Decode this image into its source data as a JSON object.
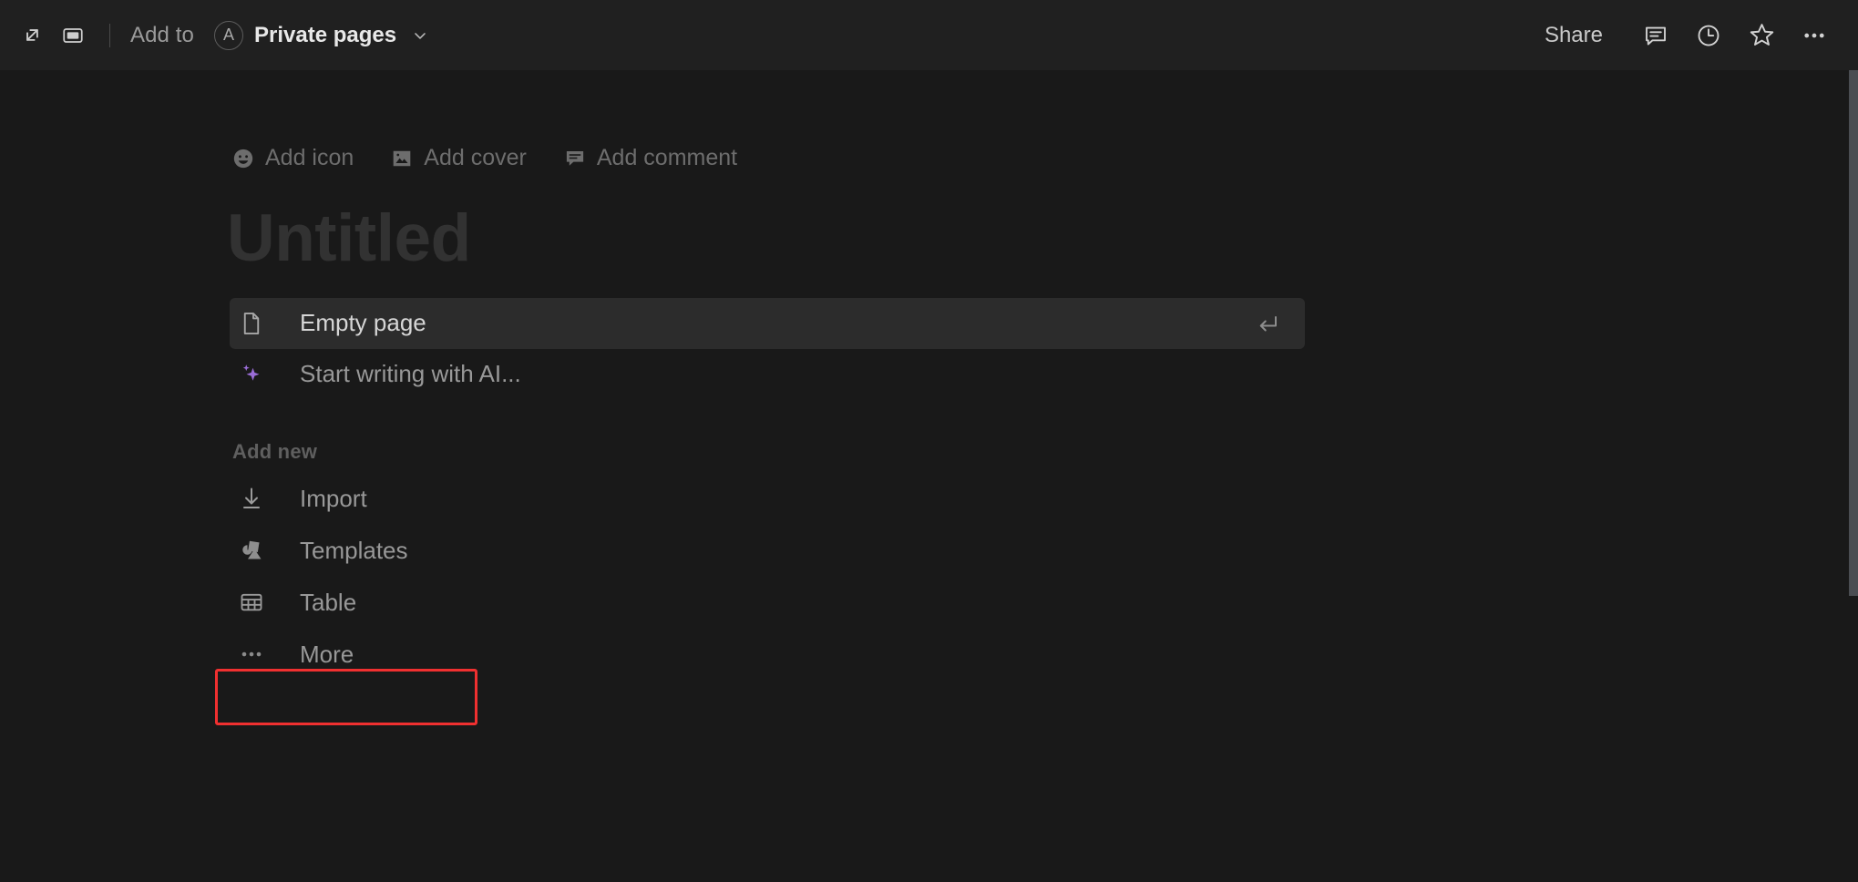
{
  "topbar": {
    "expand_icon": "expand-arrows-icon",
    "peek_icon": "side-peek-icon",
    "add_to_label": "Add to",
    "avatar_letter": "A",
    "breadcrumb_label": "Private pages",
    "chevron_icon": "chevron-down-icon",
    "share_label": "Share",
    "comment_icon": "comment-icon",
    "history_icon": "clock-history-icon",
    "favorite_icon": "star-icon",
    "more_icon": "more-horizontal-icon"
  },
  "page": {
    "meta_actions": [
      {
        "icon": "smiley-icon",
        "label": "Add icon"
      },
      {
        "icon": "image-icon",
        "label": "Add cover"
      },
      {
        "icon": "comment-icon",
        "label": "Add comment"
      }
    ],
    "title_placeholder": "Untitled",
    "suggestions": [
      {
        "icon": "page-icon",
        "label": "Empty page",
        "selected": true,
        "hint": "enter-key-icon"
      },
      {
        "icon": "sparkles-icon",
        "label": "Start writing with AI...",
        "selected": false,
        "hint": ""
      }
    ],
    "add_new_label": "Add new",
    "add_new_items": [
      {
        "icon": "import-arrow-icon",
        "label": "Import"
      },
      {
        "icon": "templates-shapes-icon",
        "label": "Templates"
      },
      {
        "icon": "table-icon",
        "label": "Table"
      },
      {
        "icon": "more-horizontal-icon",
        "label": "More"
      }
    ]
  },
  "colors": {
    "background": "#191919",
    "topbar": "#202020",
    "selected_row": "#2c2c2c",
    "accent_ai": "#9a6dd7",
    "highlight_box": "#f03030",
    "text_primary": "#d6d6d6",
    "text_muted": "#6d6d6d",
    "scrollbar_thumb": "#4a4d52"
  }
}
